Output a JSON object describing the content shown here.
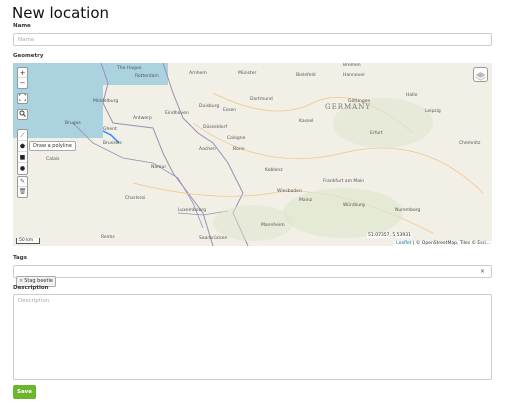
{
  "page": {
    "title": "New location"
  },
  "name_field": {
    "label": "Name",
    "placeholder": "Name"
  },
  "geometry": {
    "label": "Geometry",
    "controls": {
      "zoom_in": "+",
      "zoom_out": "−",
      "fullscreen_icon": "fullscreen-icon",
      "search_icon": "search-icon",
      "draw_tools": [
        "polyline-icon",
        "polygon-icon",
        "rectangle-icon",
        "marker-icon"
      ],
      "edit_tools": [
        "edit-icon",
        "delete-icon"
      ],
      "tooltip": "Draw a polyline"
    },
    "map": {
      "country_label": "GERMANY",
      "cities": [
        "The Hague",
        "Rotterdam",
        "Arnhem",
        "Münster",
        "Bielefeld",
        "Hannover",
        "Bremen",
        "Antwerp",
        "Eindhoven",
        "Dortmund",
        "Duisburg",
        "Essen",
        "Düsseldorf",
        "Kassel",
        "Göttingen",
        "Halle",
        "Leipzig",
        "Erfurt",
        "Brussels",
        "Aachen",
        "Cologne",
        "Bonn",
        "Koblenz",
        "Frankfurt am Main",
        "Wiesbaden",
        "Mainz",
        "Namur",
        "Charleroi",
        "Ghent",
        "Bruges",
        "Middelburg",
        "Luxembourg",
        "Saarbrücken",
        "Mannheim",
        "Würzburg",
        "Nuremberg",
        "Reims",
        "Calais",
        "Chemnitz"
      ],
      "scale": "50 km",
      "coordinates": "51.07357, 5.53931",
      "attribution_leaflet": "Leaflet",
      "attribution_rest": " | © OpenStreetMap, Tiles © Esri..."
    }
  },
  "tags_field": {
    "label": "Tags",
    "tags": [
      {
        "remove": "×",
        "label": "Stag beetle"
      }
    ],
    "clear": "×"
  },
  "description_field": {
    "label": "Description",
    "placeholder": "Description"
  },
  "save_button": {
    "label": "Save"
  },
  "colors": {
    "accent": "#6cb52d",
    "water": "#aad3df",
    "land": "#f1efe6"
  }
}
